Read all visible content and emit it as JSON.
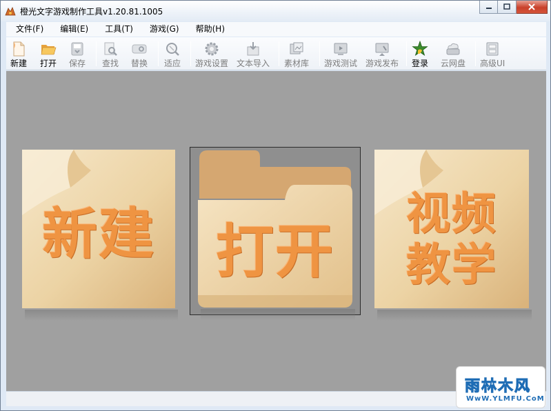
{
  "window": {
    "title": "橙光文字游戏制作工具v1.20.81.1005"
  },
  "menu": {
    "items": [
      {
        "label": "文件(F)"
      },
      {
        "label": "编辑(E)"
      },
      {
        "label": "工具(T)"
      },
      {
        "label": "游戏(G)"
      },
      {
        "label": "帮助(H)"
      }
    ]
  },
  "toolbar": {
    "new": "新建",
    "open": "打开",
    "save": "保存",
    "find": "查找",
    "replace": "替换",
    "fit": "适应",
    "game_settings": "游戏设置",
    "text_import": "文本导入",
    "asset_library": "素材库",
    "game_test": "游戏测试",
    "game_publish": "游戏发布",
    "login": "登录",
    "cloud_drive": "云网盘",
    "advanced_ui": "高级UI"
  },
  "cards": {
    "new": "新建",
    "open": "打开",
    "video_line1": "视频",
    "video_line2": "教学"
  },
  "watermark": {
    "cn": "雨林木风",
    "en": "WwW.YLMFU.CoM"
  },
  "colors": {
    "card_text": "#ef9442",
    "workarea": "#a0a0a0",
    "watermark_blue": "#1f6db5"
  }
}
